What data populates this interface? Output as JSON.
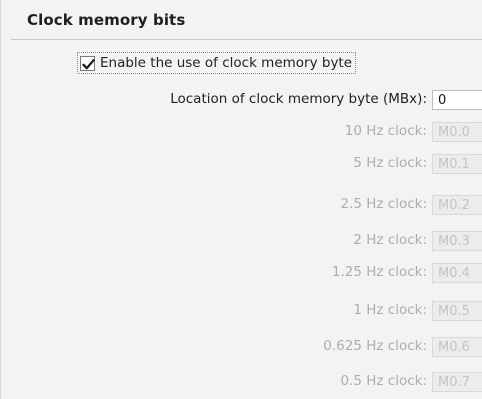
{
  "section": {
    "title": "Clock memory bits"
  },
  "enable_clock": {
    "label": "Enable the use of clock memory byte",
    "checked": true
  },
  "location": {
    "label": "Location of clock memory byte (MBx):",
    "value": "0"
  },
  "clock_bits": [
    {
      "label": "10 Hz clock:",
      "value": "M0.0"
    },
    {
      "label": "5 Hz clock:",
      "value": "M0.1"
    },
    {
      "label": "2.5 Hz clock:",
      "value": "M0.2"
    },
    {
      "label": "2 Hz clock:",
      "value": "M0.3"
    },
    {
      "label": "1.25 Hz clock:",
      "value": "M0.4"
    },
    {
      "label": "1 Hz clock:",
      "value": "M0.5"
    },
    {
      "label": "0.625 Hz clock:",
      "value": "M0.6"
    },
    {
      "label": "0.5 Hz clock:",
      "value": "M0.7"
    }
  ]
}
